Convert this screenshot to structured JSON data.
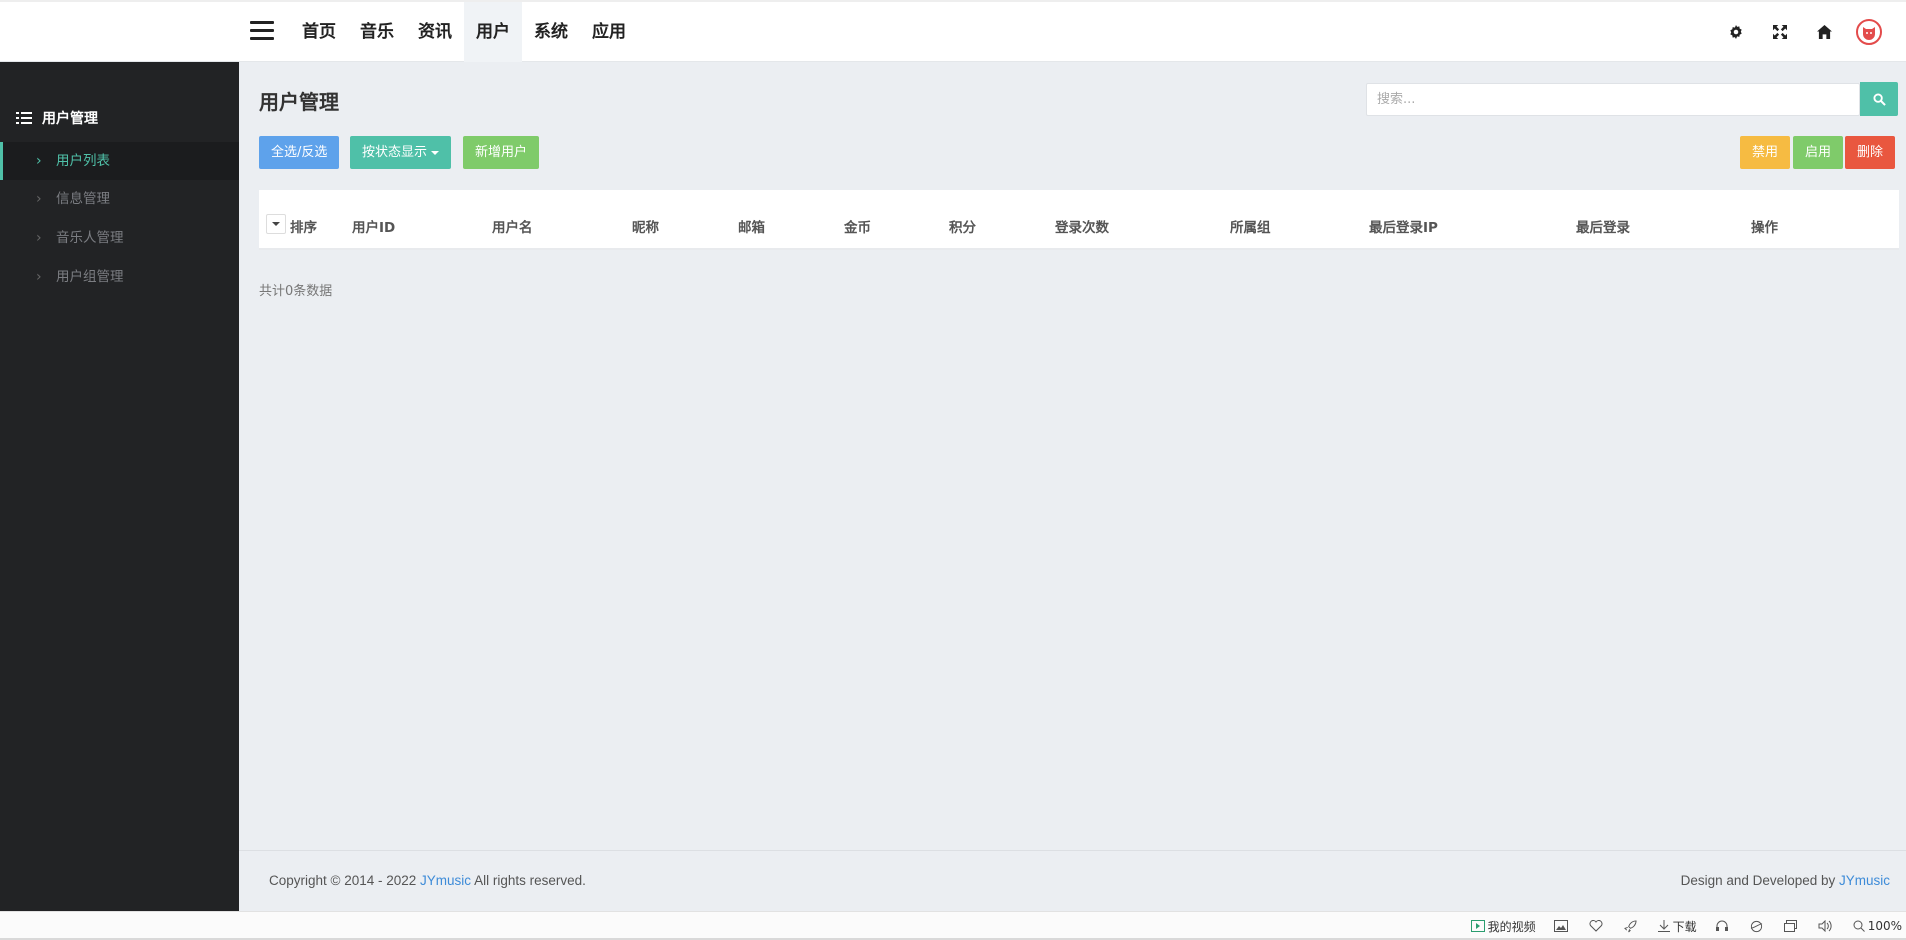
{
  "header": {
    "nav": [
      "首页",
      "音乐",
      "资讯",
      "用户",
      "系统",
      "应用"
    ],
    "active_nav": "用户",
    "icons": [
      "gear-icon",
      "expand-icon",
      "home-icon",
      "avatar-icon"
    ]
  },
  "sidebar": {
    "title": "用户管理",
    "items": [
      {
        "label": "用户列表",
        "active": true
      },
      {
        "label": "信息管理",
        "active": false
      },
      {
        "label": "音乐人管理",
        "active": false
      },
      {
        "label": "用户组管理",
        "active": false
      }
    ]
  },
  "main": {
    "page_title": "用户管理",
    "search_placeholder": "搜索...",
    "buttons": {
      "select_all": "全选/反选",
      "filter_status": "按状态显示",
      "add_user": "新增用户",
      "disable": "禁用",
      "enable": "启用",
      "delete": "删除"
    },
    "columns": [
      "排序",
      "用户ID",
      "用户名",
      "昵称",
      "邮箱",
      "金币",
      "积分",
      "登录次数",
      "所属组",
      "最后登录IP",
      "最后登录",
      "操作"
    ],
    "total_text": "共计0条数据"
  },
  "footer": {
    "copyright_prefix": "Copyright © 2014 - 2022 ",
    "brand": "JYmusic",
    "copyright_suffix": " All rights reserved.",
    "credit_prefix": "Design and Developed by "
  },
  "statusbar": {
    "my_video": "我的视频",
    "download": "下载",
    "zoom": "100%"
  },
  "colors": {
    "accent": "#4fc0a8",
    "blue": "#5ea2eb",
    "green": "#7fcb6a",
    "yellow": "#f6bb42",
    "red": "#e9573f",
    "sidebar_bg": "#222325",
    "main_bg": "#ebeef2"
  }
}
